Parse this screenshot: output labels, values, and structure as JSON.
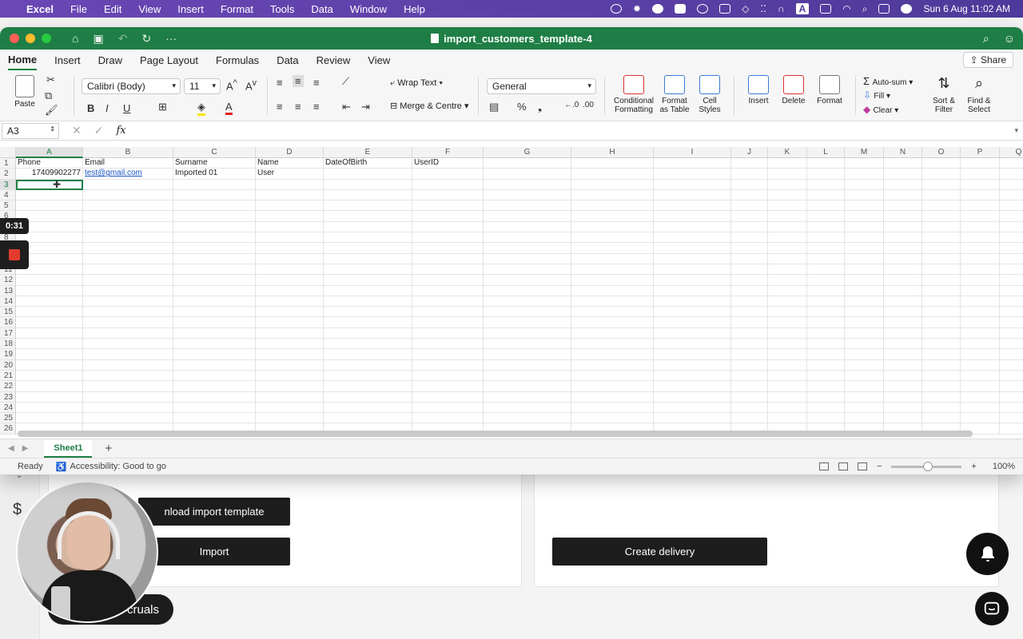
{
  "menubar": {
    "app": "Excel",
    "menus": [
      "File",
      "Edit",
      "View",
      "Insert",
      "Format",
      "Tools",
      "Data",
      "Window",
      "Help"
    ],
    "datetime": "Sun 6 Aug  11:02 AM",
    "input_indicator": "A"
  },
  "window": {
    "title": "import_customers_template-4",
    "title_color": "#1e7e45"
  },
  "tabs": [
    "Home",
    "Insert",
    "Draw",
    "Page Layout",
    "Formulas",
    "Data",
    "Review",
    "View"
  ],
  "active_tab": "Home",
  "share_label": "Share",
  "ribbon": {
    "paste": "Paste",
    "font_name": "Calibri (Body)",
    "font_size": "11",
    "bold": "B",
    "italic": "I",
    "underline": "U",
    "wrap_text": "Wrap Text",
    "merge_centre": "Merge & Centre",
    "number_format": "General",
    "percent": "%",
    "conditional_formatting_1": "Conditional",
    "conditional_formatting_2": "Formatting",
    "format_as_table_1": "Format",
    "format_as_table_2": "as Table",
    "cell_styles_1": "Cell",
    "cell_styles_2": "Styles",
    "insert": "Insert",
    "delete": "Delete",
    "format": "Format",
    "autosum": "Auto-sum",
    "fill": "Fill",
    "clear": "Clear",
    "sort_filter_1": "Sort &",
    "sort_filter_2": "Filter",
    "find_select_1": "Find &",
    "find_select_2": "Select"
  },
  "formula_bar": {
    "name_box": "A3",
    "fx": "fx",
    "content": ""
  },
  "sheet": {
    "columns": [
      "A",
      "B",
      "C",
      "D",
      "E",
      "F",
      "G",
      "H",
      "I",
      "J",
      "K",
      "L",
      "M",
      "N",
      "O",
      "P",
      "Q"
    ],
    "rows": [
      "1",
      "2",
      "3",
      "4",
      "5",
      "6",
      "7",
      "8",
      "9",
      "10",
      "11",
      "12",
      "13",
      "14",
      "15",
      "16",
      "17",
      "18",
      "19",
      "20",
      "21",
      "22",
      "23",
      "24",
      "25",
      "26"
    ],
    "header_row": [
      "Phone",
      "Email",
      "Surname",
      "Name",
      "DateOfBirth",
      "UserID"
    ],
    "data_row": [
      "17409902277",
      "test@gmail.com",
      "Imported 01",
      "User",
      "",
      ""
    ],
    "active_cell": "A3"
  },
  "sheet_tabs": [
    "Sheet1"
  ],
  "status": {
    "ready": "Ready",
    "accessibility": "Accessibility: Good to go",
    "zoom": "100%"
  },
  "recording": {
    "timer": "0:31"
  },
  "background_app": {
    "download_template": "nload import template",
    "import": "Import",
    "create_delivery": "Create delivery",
    "accruals": "cruals"
  }
}
